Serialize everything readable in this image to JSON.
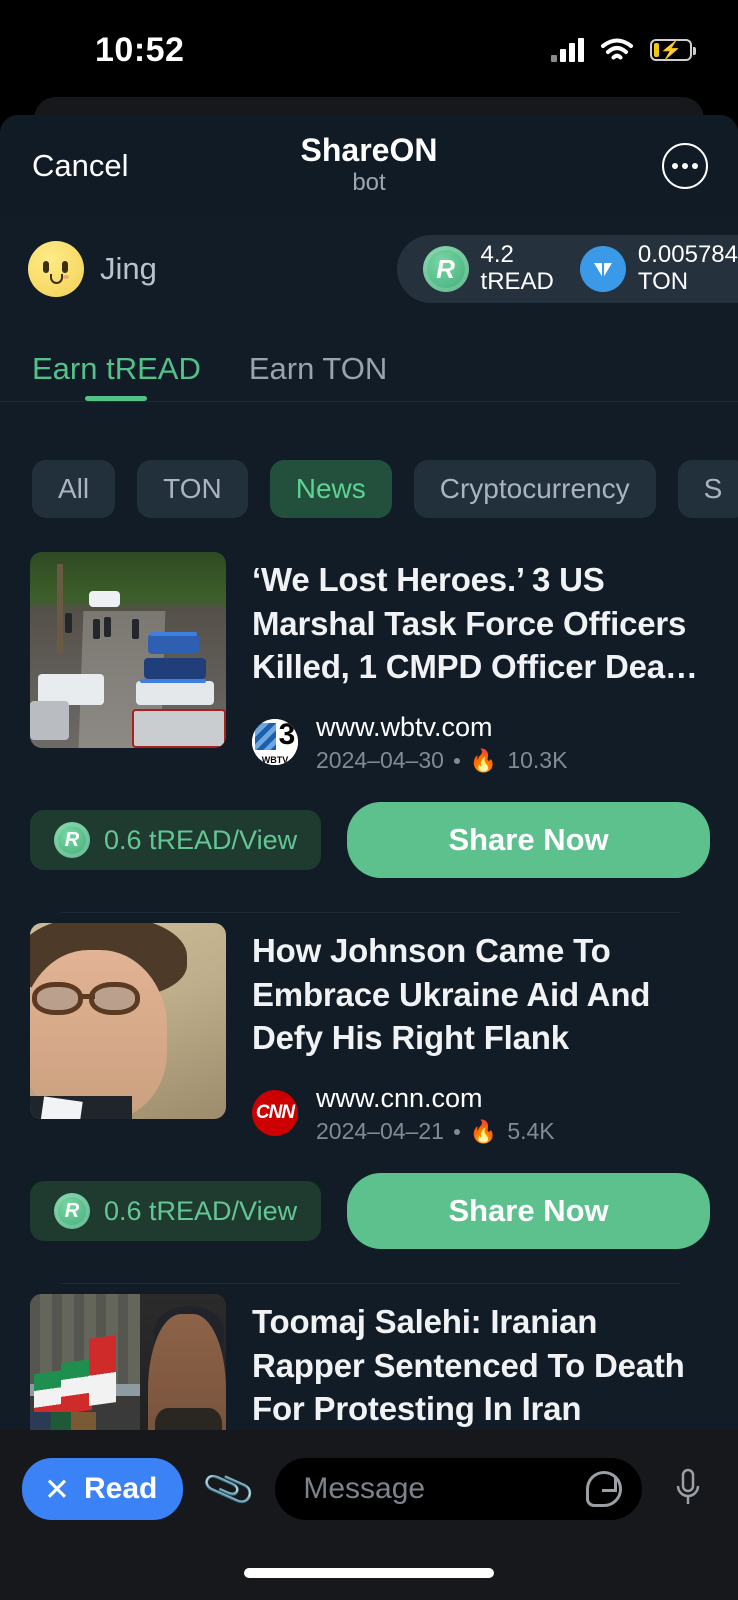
{
  "status_bar": {
    "time": "10:52",
    "signal_icon": "cellular-signal-icon",
    "wifi_icon": "wifi-icon",
    "battery_icon": "battery-charging-icon"
  },
  "nav": {
    "cancel_label": "Cancel",
    "title": "ShareON",
    "subtitle": "bot",
    "more_icon": "more-options-icon"
  },
  "user": {
    "name": "Jing",
    "avatar_icon": "smiley-avatar-icon",
    "balances": [
      {
        "icon": "tread-coin-icon",
        "amount": "4.2",
        "unit": "tREAD"
      },
      {
        "icon": "ton-coin-icon",
        "amount": "0.005784",
        "unit": "TON"
      }
    ]
  },
  "tabs": [
    {
      "label": "Earn tREAD",
      "active": true
    },
    {
      "label": "Earn TON",
      "active": false
    }
  ],
  "chips": [
    {
      "label": "All",
      "active": false
    },
    {
      "label": "TON",
      "active": false
    },
    {
      "label": "News",
      "active": true
    },
    {
      "label": "Cryptocurrency",
      "active": false
    },
    {
      "label": "S",
      "active": false
    }
  ],
  "articles": [
    {
      "headline": "‘We Lost Heroes.’ 3 US Marshal Task Force Officers Killed, 1 CMPD Officer Dea…",
      "thumbnail": "police-street-scene",
      "favicon": "wbtv-logo-icon",
      "url": "www.wbtv.com",
      "date": "2024–04–30",
      "views": "10.3K",
      "views_icon": "flame-icon",
      "reward": "0.6 tREAD/View",
      "reward_icon": "tread-coin-icon",
      "share_label": "Share Now"
    },
    {
      "headline": "How Johnson Came To Embrace Ukraine Aid And Defy His Right Flank",
      "thumbnail": "politician-portrait",
      "favicon": "cnn-logo-icon",
      "url": "www.cnn.com",
      "date": "2024–04–21",
      "views": "5.4K",
      "views_icon": "flame-icon",
      "reward": "0.6 tREAD/View",
      "reward_icon": "tread-coin-icon",
      "share_label": "Share Now"
    },
    {
      "headline": "Toomaj Salehi: Iranian Rapper Sentenced To Death For Protesting In Iran",
      "thumbnail": "iran-protest-scene"
    }
  ],
  "input_bar": {
    "read_label": "Read",
    "read_close_icon": "close-x-icon",
    "attach_icon": "paperclip-icon",
    "message_placeholder": "Message",
    "sticker_icon": "sticker-icon",
    "mic_icon": "microphone-icon"
  },
  "colors": {
    "accent_green": "#5cc18d",
    "chip_active_bg": "#22503d",
    "sheet_bg": "#111c27",
    "read_blue": "#3b82f6",
    "ton_blue": "#3a9ae8"
  }
}
